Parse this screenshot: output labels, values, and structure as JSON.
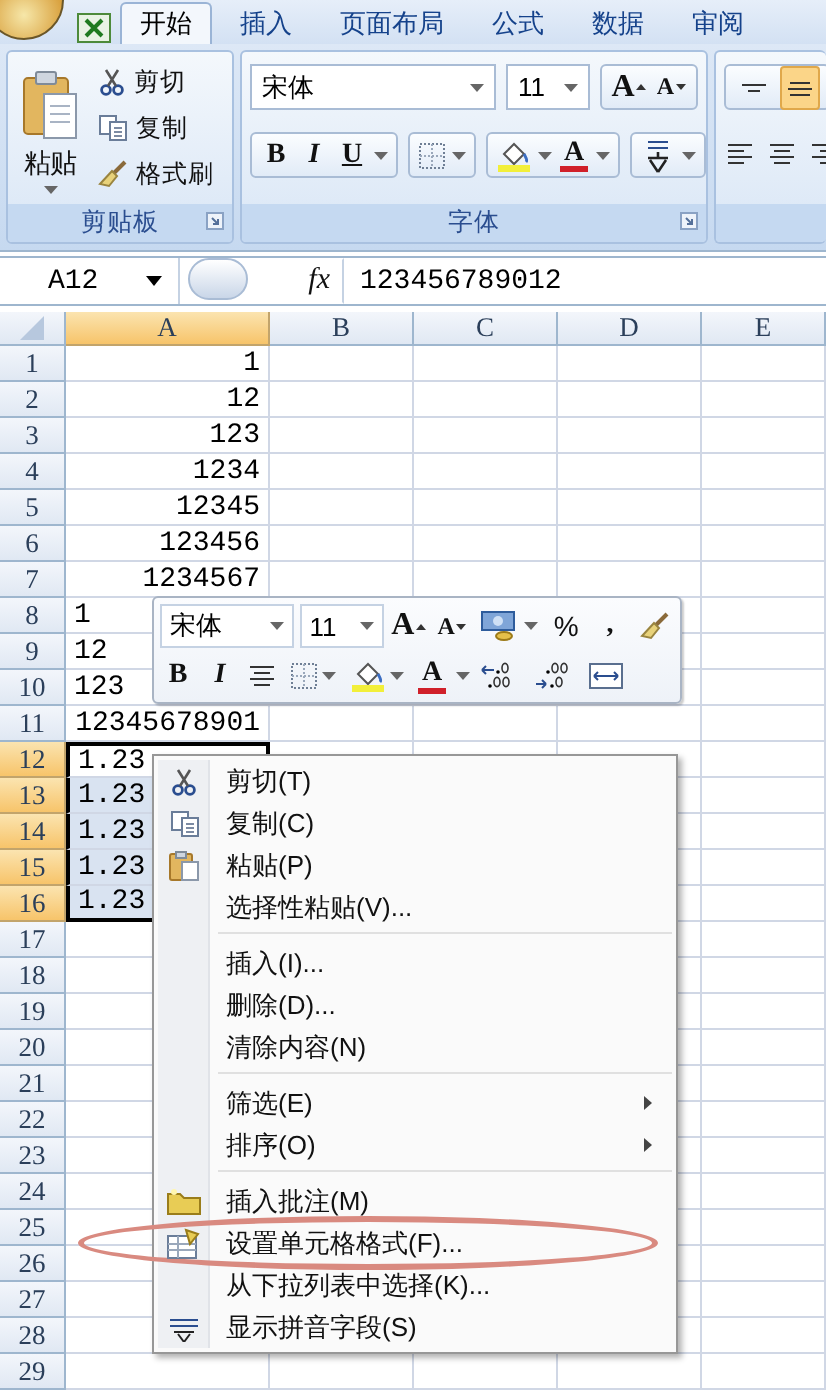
{
  "ribbon": {
    "tabs": [
      {
        "label": "开始",
        "selected": true
      },
      {
        "label": "插入",
        "selected": false
      },
      {
        "label": "页面布局",
        "selected": false
      },
      {
        "label": "公式",
        "selected": false
      },
      {
        "label": "数据",
        "selected": false
      },
      {
        "label": "审阅",
        "selected": false
      }
    ],
    "groups": [
      {
        "kind": "clipboard",
        "title": "剪贴板",
        "paste": "粘贴",
        "items": [
          "剪切",
          "复制",
          "格式刷"
        ]
      },
      {
        "kind": "font",
        "title": "字体",
        "font": "宋体",
        "size": "11",
        "grow": "A",
        "shrink": "A",
        "bold": "B",
        "italic": "I",
        "underline": "U",
        "font_color": "A"
      },
      {
        "kind": "alignment",
        "vertical": [
          {
            "selected": false
          },
          {
            "selected": true
          }
        ]
      }
    ]
  },
  "formula_bar": {
    "name_box": "A12",
    "function_label": "fx",
    "value": "123456789012"
  },
  "sheet": {
    "columns": [
      {
        "label": "A",
        "selected": true
      },
      {
        "label": "B",
        "selected": false
      },
      {
        "label": "C",
        "selected": false
      },
      {
        "label": "D",
        "selected": false
      },
      {
        "label": "E",
        "selected": false
      }
    ],
    "rows": [
      {
        "header": "1",
        "value": "1",
        "clipped": false,
        "selected": false,
        "active": false
      },
      {
        "header": "2",
        "value": "12",
        "clipped": false,
        "selected": false,
        "active": false
      },
      {
        "header": "3",
        "value": "123",
        "clipped": false,
        "selected": false,
        "active": false
      },
      {
        "header": "4",
        "value": "1234",
        "clipped": false,
        "selected": false,
        "active": false
      },
      {
        "header": "5",
        "value": "12345",
        "clipped": false,
        "selected": false,
        "active": false
      },
      {
        "header": "6",
        "value": "123456",
        "clipped": false,
        "selected": false,
        "active": false
      },
      {
        "header": "7",
        "value": "1234567",
        "clipped": false,
        "selected": false,
        "active": false
      },
      {
        "header": "8",
        "value": "1",
        "clipped": true,
        "selected": false,
        "active": false
      },
      {
        "header": "9",
        "value": "12",
        "clipped": true,
        "selected": false,
        "active": false
      },
      {
        "header": "10",
        "value": "123",
        "clipped": true,
        "selected": false,
        "active": false
      },
      {
        "header": "11",
        "value": "12345678901",
        "clipped": false,
        "selected": false,
        "active": false
      },
      {
        "header": "12",
        "value": "1.23",
        "clipped": true,
        "selected": true,
        "active": true
      },
      {
        "header": "13",
        "value": "1.23",
        "clipped": true,
        "selected": true,
        "active": false
      },
      {
        "header": "14",
        "value": "1.23",
        "clipped": true,
        "selected": true,
        "active": false
      },
      {
        "header": "15",
        "value": "1.23",
        "clipped": true,
        "selected": true,
        "active": false
      },
      {
        "header": "16",
        "value": "1.23",
        "clipped": true,
        "selected": true,
        "active": false
      },
      {
        "header": "17",
        "selected": false,
        "active": false
      },
      {
        "header": "18",
        "selected": false,
        "active": false
      },
      {
        "header": "19",
        "selected": false,
        "active": false
      },
      {
        "header": "20",
        "selected": false,
        "active": false
      },
      {
        "header": "21",
        "selected": false,
        "active": false
      },
      {
        "header": "22",
        "selected": false,
        "active": false
      },
      {
        "header": "23",
        "selected": false,
        "active": false
      },
      {
        "header": "24",
        "selected": false,
        "active": false
      },
      {
        "header": "25",
        "selected": false,
        "active": false
      },
      {
        "header": "26",
        "selected": false,
        "active": false
      },
      {
        "header": "27",
        "selected": false,
        "active": false
      },
      {
        "header": "28",
        "selected": false,
        "active": false
      },
      {
        "header": "29",
        "selected": false,
        "active": false
      }
    ]
  },
  "mini_toolbar": {
    "font": "宋体",
    "size": "11",
    "grow": "A",
    "shrink": "A",
    "percent": "%",
    "comma": ",",
    "bold": "B",
    "italic": "I",
    "font_color": "A"
  },
  "context_menu": {
    "items": [
      {
        "kind": "item",
        "label": "剪切(T)",
        "annotated": false
      },
      {
        "kind": "item",
        "label": "复制(C)",
        "annotated": false
      },
      {
        "kind": "item",
        "label": "粘贴(P)",
        "annotated": false
      },
      {
        "kind": "item",
        "label": "选择性粘贴(V)...",
        "annotated": false
      },
      {
        "kind": "separator"
      },
      {
        "kind": "item",
        "label": "插入(I)...",
        "annotated": false
      },
      {
        "kind": "item",
        "label": "删除(D)...",
        "annotated": false
      },
      {
        "kind": "item",
        "label": "清除内容(N)",
        "annotated": false
      },
      {
        "kind": "separator"
      },
      {
        "kind": "submenu",
        "label": "筛选(E)",
        "annotated": false
      },
      {
        "kind": "submenu",
        "label": "排序(O)",
        "annotated": false
      },
      {
        "kind": "separator"
      },
      {
        "kind": "item",
        "label": "插入批注(M)",
        "annotated": false
      },
      {
        "kind": "item",
        "label": "设置单元格格式(F)...",
        "annotated": true
      },
      {
        "kind": "item",
        "label": "从下拉列表中选择(K)...",
        "annotated": false
      },
      {
        "kind": "item",
        "label": "显示拼音字段(S)",
        "annotated": false
      }
    ]
  }
}
